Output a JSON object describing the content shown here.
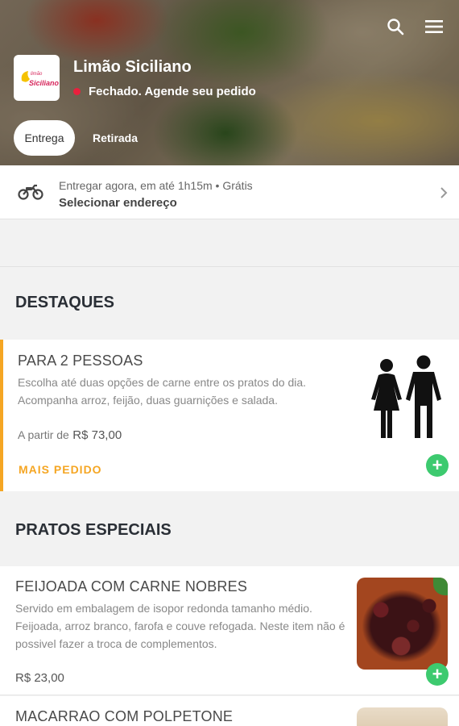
{
  "header": {
    "restaurant_name": "Limão Siciliano",
    "logo_text": "Siciliano",
    "status_text": "Fechado. Agende seu pedido",
    "status_color": "#e8203d",
    "tabs": [
      {
        "label": "Entrega",
        "selected": true
      },
      {
        "label": "Retirada",
        "selected": false
      }
    ],
    "icons": [
      "search-icon",
      "menu-icon"
    ]
  },
  "delivery": {
    "line1": "Entregar agora, em até 1h15m • Grátis",
    "line2": "Selecionar endereço",
    "icon": "motorcycle-icon"
  },
  "sections": [
    {
      "title": "DESTAQUES",
      "items": [
        {
          "name": "PARA 2 PESSOAS",
          "description": "Escolha até duas opções de carne entre os pratos do dia. Acompanha arroz, feijão, duas guarnições e salada.",
          "price_prefix": "A partir de",
          "price": "R$ 73,00",
          "badge": "MAIS PEDIDO",
          "image_icon": "couple-icon"
        }
      ]
    },
    {
      "title": "PRATOS ESPECIAIS",
      "items": [
        {
          "name": "FEIJOADA COM CARNE NOBRES",
          "description": "Servido em embalagem de isopor redonda tamanho médio. Feijoada, arroz branco, farofa e couve refogada. Neste item não é possivel fazer a troca de complementos.",
          "price": "R$ 23,00"
        },
        {
          "name": "MACARRAO COM POLPETONE"
        }
      ]
    }
  ],
  "colors": {
    "accent_orange": "#f5a623",
    "add_button_green": "#3dca6f"
  }
}
